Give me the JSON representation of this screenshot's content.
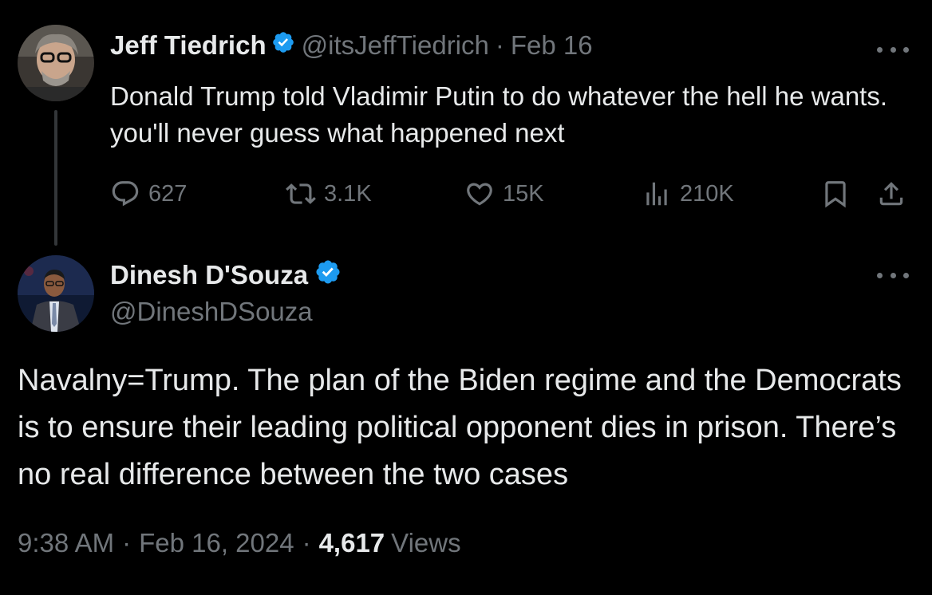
{
  "tweet1": {
    "author_name": "Jeff Tiedrich",
    "handle": "@itsJeffTiedrich",
    "separator": "·",
    "date": "Feb 16",
    "text": "Donald Trump told Vladimir Putin to do whatever the hell he wants. you'll never guess what happened next",
    "actions": {
      "replies": "627",
      "retweets": "3.1K",
      "likes": "15K",
      "views": "210K"
    }
  },
  "tweet2": {
    "author_name": "Dinesh D'Souza",
    "handle": "@DineshDSouza",
    "text": "Navalny=Trump. The plan of the Biden regime and the Democrats is to ensure their leading political opponent dies in prison. There’s no real difference between the two cases",
    "time": "9:38 AM",
    "separator": "·",
    "date": "Feb 16, 2024",
    "views_count": "4,617",
    "views_label": "Views"
  },
  "colors": {
    "background": "#000000",
    "text_primary": "#e7e9ea",
    "text_secondary": "#71767b",
    "verified_blue": "#1d9bf0",
    "thread_line": "#333639"
  },
  "icons": [
    "verified-badge-icon",
    "more-icon",
    "reply-icon",
    "retweet-icon",
    "like-icon",
    "views-icon",
    "bookmark-icon",
    "share-icon"
  ]
}
